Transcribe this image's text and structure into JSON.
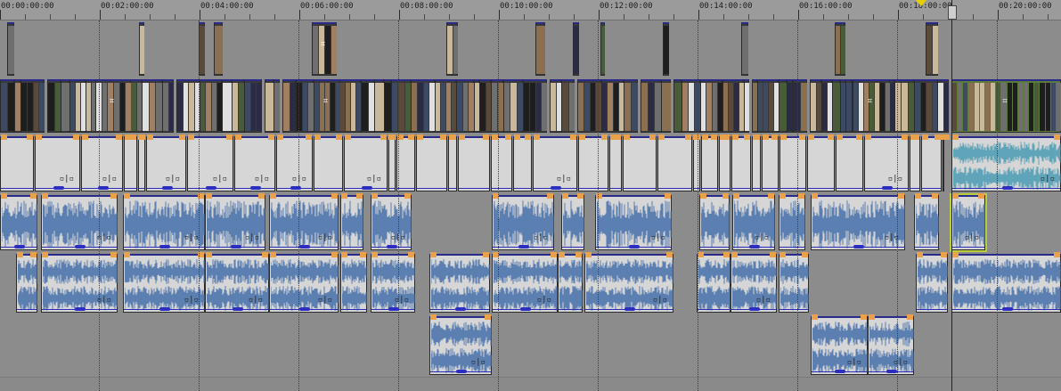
{
  "ruler": {
    "labels": [
      "00:00:00:00",
      "00:02:00:00",
      "00:04:00:00",
      "00:06:00:00",
      "00:08:00:00",
      "00:10:00:00",
      "00:12:00:00",
      "00:14:00:00",
      "00:16:00:00",
      "00:18:00:00",
      "00:20:00:00"
    ]
  },
  "playhead": {
    "time": "00:18:30:00"
  },
  "clip_control_glyph": "▫|▫",
  "crop_glyph": "⌗",
  "colors": {
    "background": "#8a8a8a",
    "audio_clip": "#d6d6d6",
    "waveform": "#5a7fb0",
    "waveform_alt": "#5fa4b8",
    "fade_handle": "#e9a24a",
    "volume_line": "#2b2bb5",
    "selection": "#b9cf3a"
  },
  "tracks": [
    {
      "name": "video-track-1",
      "kind": "video"
    },
    {
      "name": "video-track-2",
      "kind": "video"
    },
    {
      "name": "audio-track-1",
      "kind": "audio"
    },
    {
      "name": "audio-track-2",
      "kind": "audio"
    },
    {
      "name": "audio-track-3",
      "kind": "audio"
    },
    {
      "name": "audio-track-4",
      "kind": "audio"
    }
  ]
}
